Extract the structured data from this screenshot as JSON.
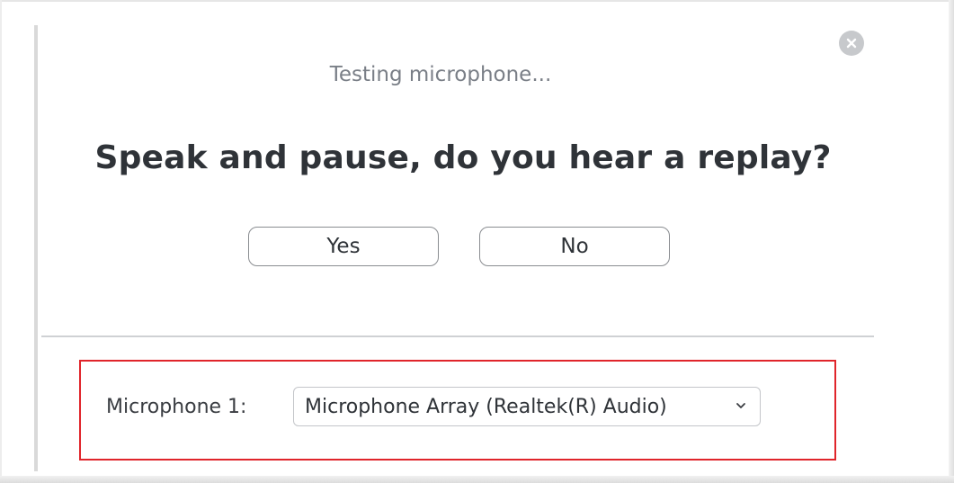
{
  "dialog": {
    "status_text": "Testing microphone...",
    "question": "Speak and pause, do you hear a replay?",
    "buttons": {
      "yes_label": "Yes",
      "no_label": "No"
    },
    "microphone": {
      "label": "Microphone 1:",
      "selected": "Microphone Array (Realtek(R) Audio)"
    }
  },
  "icons": {
    "close": "close-icon",
    "dropdown": "chevron-down-icon"
  },
  "colors": {
    "highlight_border": "#e0252b",
    "close_button": "#c7c9cc",
    "text_dark": "#2f3338",
    "text_muted": "#7a7f87"
  }
}
